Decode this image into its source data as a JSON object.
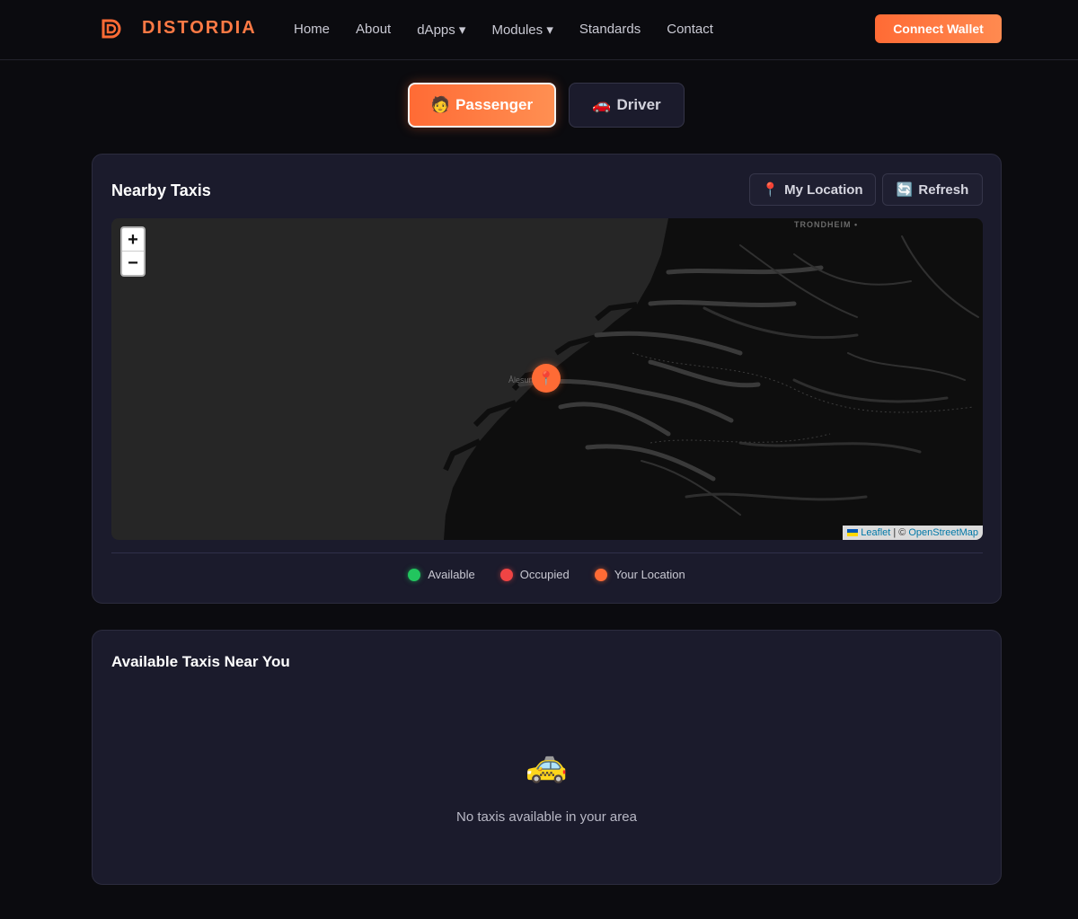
{
  "header": {
    "brand": "DISTORDIA",
    "nav": [
      "Home",
      "About",
      "dApps ▾",
      "Modules ▾",
      "Standards",
      "Contact"
    ],
    "connect_label": "Connect Wallet"
  },
  "mode_toggle": {
    "passenger": {
      "icon": "🧑",
      "label": "Passenger",
      "active": true
    },
    "driver": {
      "icon": "🚗",
      "label": "Driver",
      "active": false
    }
  },
  "map_card": {
    "title": "Nearby Taxis",
    "my_location": {
      "icon": "📍",
      "label": "My Location"
    },
    "refresh": {
      "icon": "🔄",
      "label": "Refresh"
    },
    "map": {
      "zoom_in": "+",
      "zoom_out": "−",
      "city_trondheim": "TRONDHEIM •",
      "city_alesund": "Ålesund",
      "marker_icon": "📍",
      "attribution": {
        "leaflet": "Leaflet",
        "separator": "| ©",
        "osm": "OpenStreetMap"
      }
    },
    "legend": [
      {
        "label": "Available",
        "color": "#22c55e"
      },
      {
        "label": "Occupied",
        "color": "#ef4444"
      },
      {
        "label": "Your Location",
        "color": "#ff6b35"
      }
    ]
  },
  "list_card": {
    "title": "Available Taxis Near You",
    "empty_icon": "🚕",
    "empty_text": "No taxis available in your area"
  },
  "colors": {
    "accent": "#ff6b35",
    "background": "#0b0b0f",
    "card": "#1b1b2c"
  }
}
